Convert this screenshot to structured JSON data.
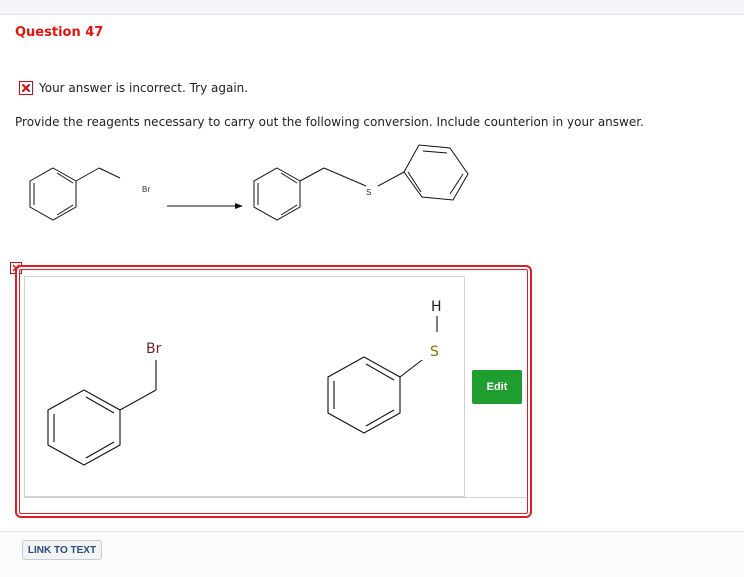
{
  "question": {
    "title": "Question 47"
  },
  "feedback": {
    "icon": "incorrect-x-icon",
    "text": "Your answer is incorrect.  Try again."
  },
  "prompt": {
    "text": "Provide the reagents necessary to carry out the following conversion. Include counterion in your answer."
  },
  "reaction": {
    "reactant_label": "Br",
    "product_label": "S"
  },
  "answer": {
    "molecule1": {
      "atom_label": "Br"
    },
    "molecule2": {
      "atom_labels": [
        "H",
        "S"
      ]
    },
    "edit_label": "Edit"
  },
  "footer": {
    "link_label": "LINK TO TEXT"
  },
  "colors": {
    "accent_red": "#e4150b",
    "edit_green": "#1f9d2f",
    "sulfur_olive": "#7a7a00",
    "bromine_brown": "#7a1f1f"
  }
}
